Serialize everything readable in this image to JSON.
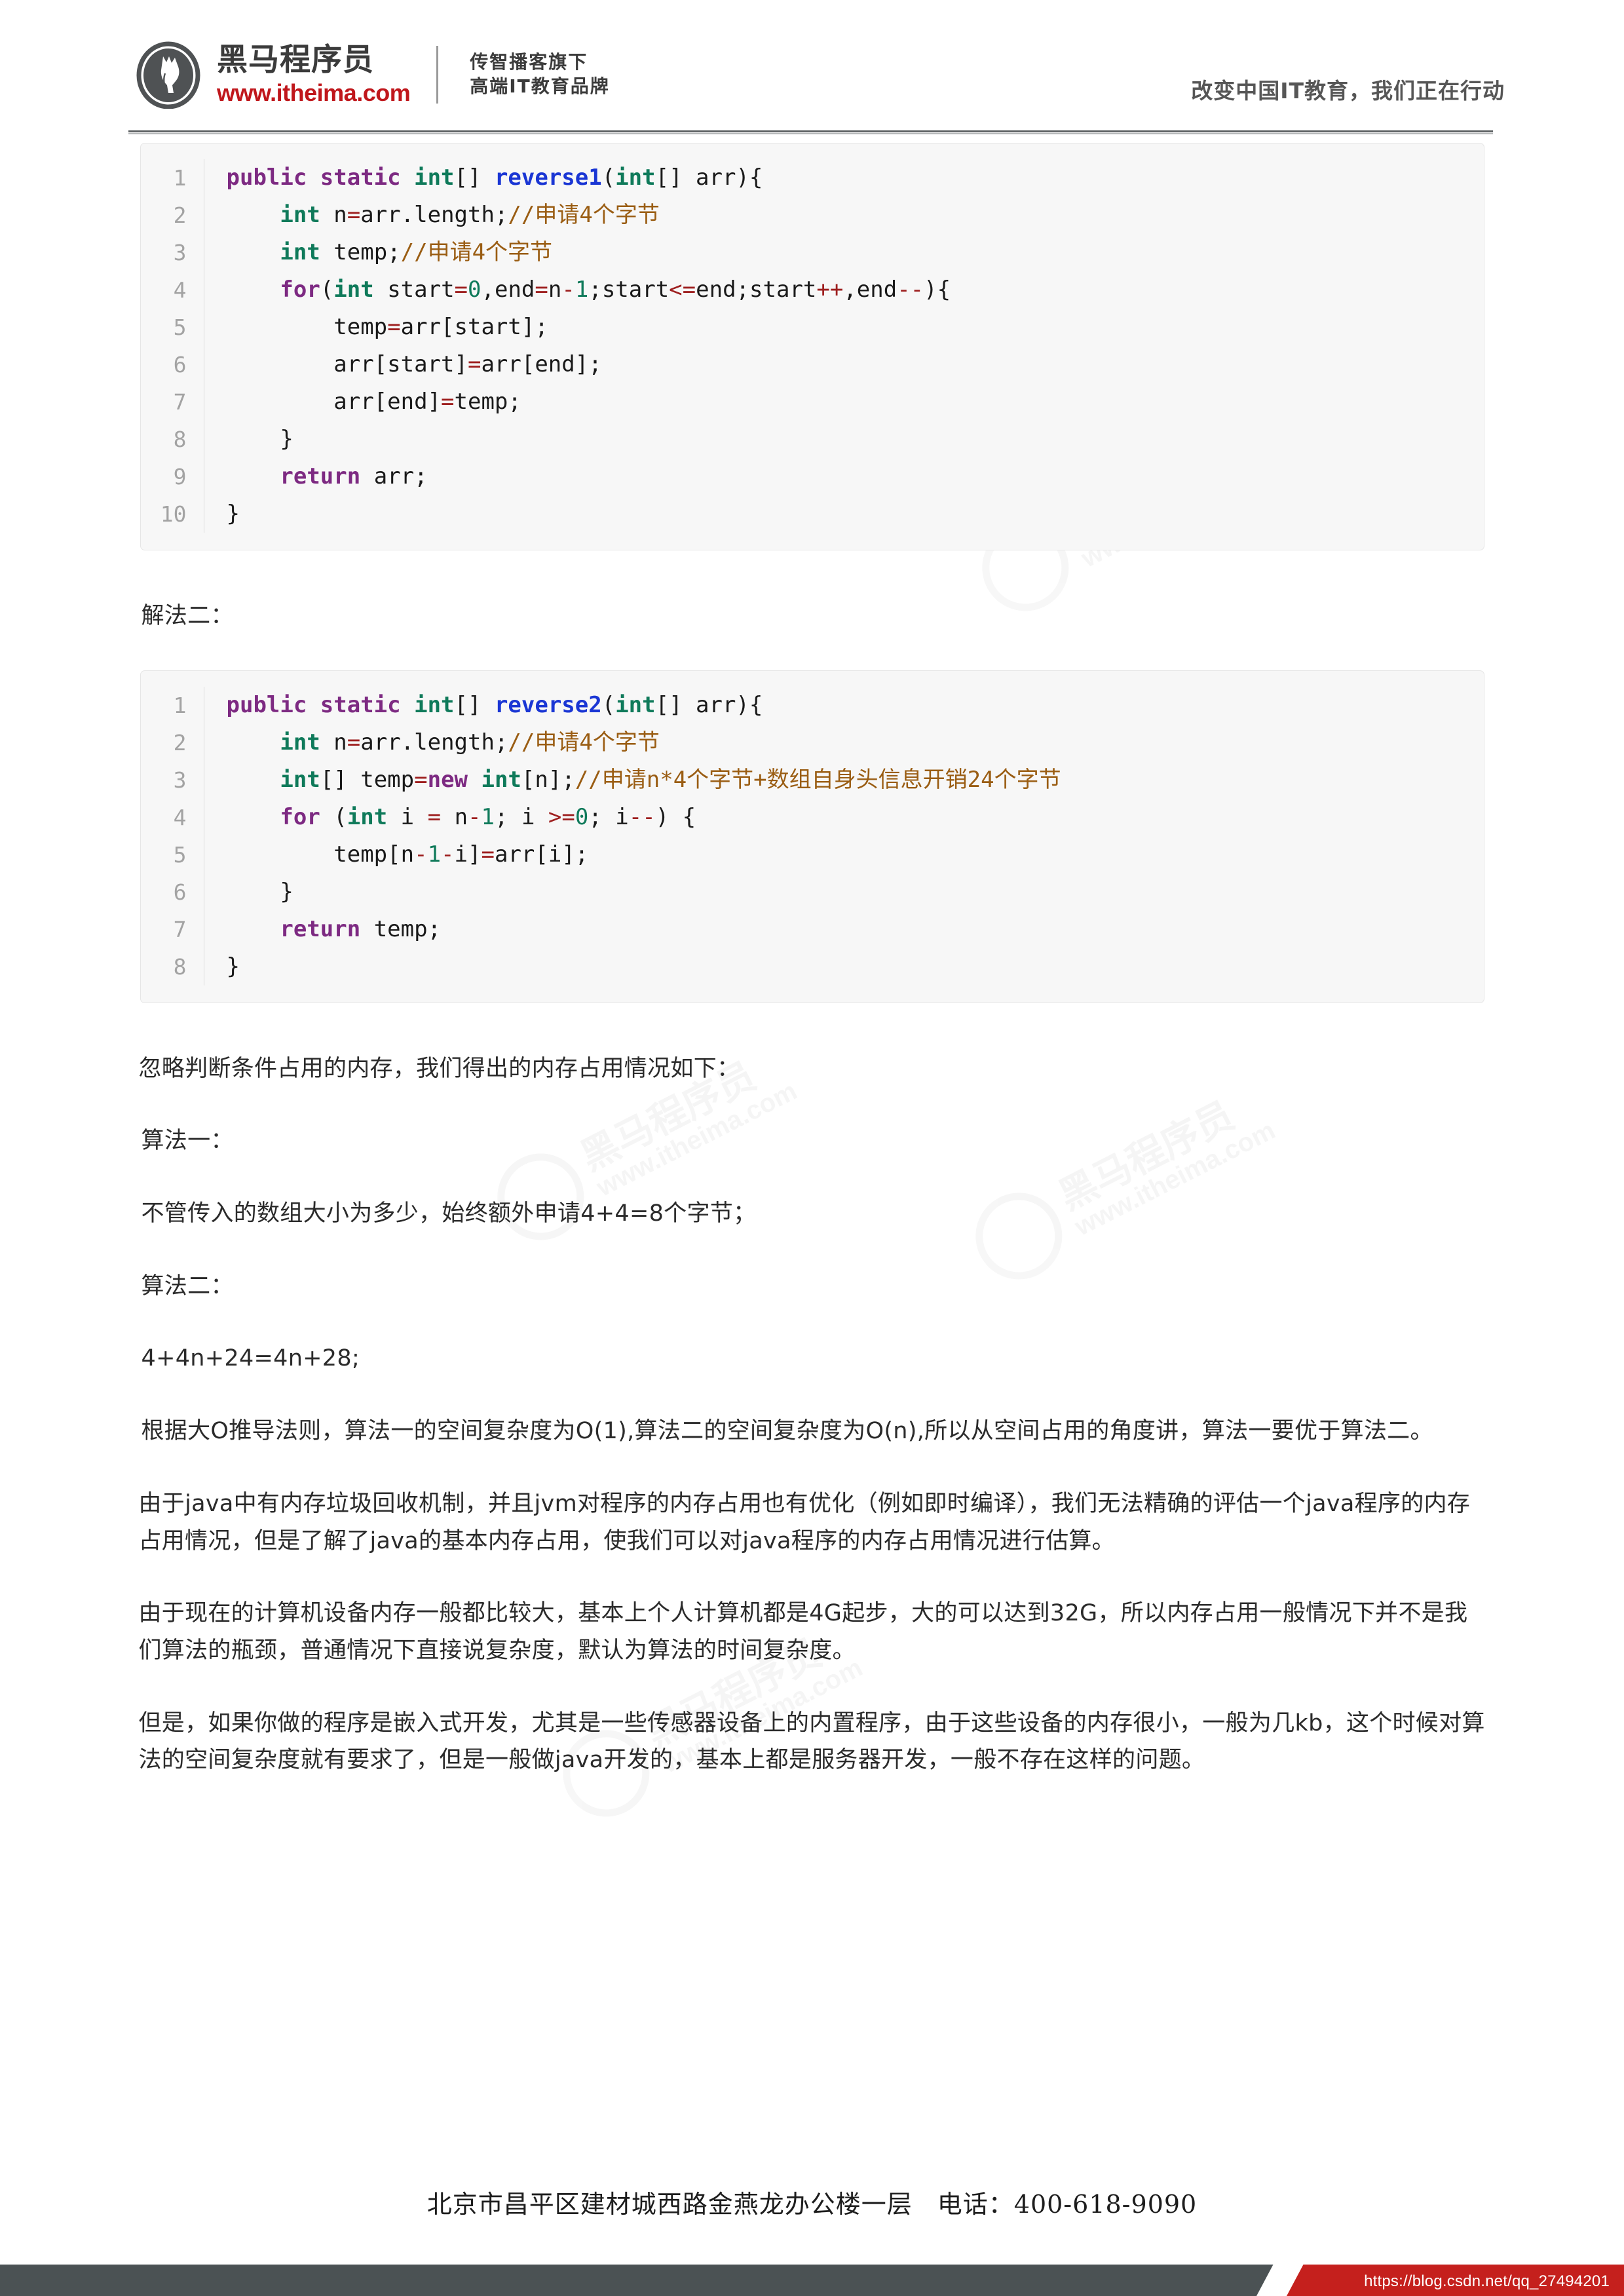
{
  "header": {
    "brand_cn": "黑马程序员",
    "brand_url": "www.itheima.com",
    "tagline_line1": "传智播客旗下",
    "tagline_line2": "高端IT教育品牌",
    "slogan": "改变中国IT教育，我们正在行动",
    "logo_icon": "horse-head-logo"
  },
  "code_block_1": {
    "name": "reverse1-code-block",
    "lines": [
      {
        "num": "1",
        "tokens": [
          {
            "t": "public ",
            "c": "kw"
          },
          {
            "t": "static ",
            "c": "kw"
          },
          {
            "t": "int",
            "c": "type"
          },
          {
            "t": "[] ",
            "c": ""
          },
          {
            "t": "reverse1",
            "c": "fn"
          },
          {
            "t": "(",
            "c": ""
          },
          {
            "t": "int",
            "c": "type"
          },
          {
            "t": "[] arr){",
            "c": ""
          }
        ]
      },
      {
        "num": "2",
        "tokens": [
          {
            "t": "    ",
            "c": ""
          },
          {
            "t": "int",
            "c": "type"
          },
          {
            "t": " n",
            "c": ""
          },
          {
            "t": "=",
            "c": "op"
          },
          {
            "t": "arr.length;",
            "c": ""
          },
          {
            "t": "//申请4个字节",
            "c": "cmt"
          }
        ]
      },
      {
        "num": "3",
        "tokens": [
          {
            "t": "    ",
            "c": ""
          },
          {
            "t": "int",
            "c": "type"
          },
          {
            "t": " temp;",
            "c": ""
          },
          {
            "t": "//申请4个字节",
            "c": "cmt"
          }
        ]
      },
      {
        "num": "4",
        "tokens": [
          {
            "t": "    ",
            "c": ""
          },
          {
            "t": "for",
            "c": "kw"
          },
          {
            "t": "(",
            "c": ""
          },
          {
            "t": "int",
            "c": "type"
          },
          {
            "t": " start",
            "c": ""
          },
          {
            "t": "=",
            "c": "op"
          },
          {
            "t": "0",
            "c": "num"
          },
          {
            "t": ",end",
            "c": ""
          },
          {
            "t": "=",
            "c": "op"
          },
          {
            "t": "n",
            "c": ""
          },
          {
            "t": "-",
            "c": "op"
          },
          {
            "t": "1",
            "c": "num"
          },
          {
            "t": ";start",
            "c": ""
          },
          {
            "t": "<=",
            "c": "op"
          },
          {
            "t": "end;start",
            "c": ""
          },
          {
            "t": "++",
            "c": "op"
          },
          {
            "t": ",end",
            "c": ""
          },
          {
            "t": "--",
            "c": "op"
          },
          {
            "t": "){",
            "c": ""
          }
        ]
      },
      {
        "num": "5",
        "tokens": [
          {
            "t": "        temp",
            "c": ""
          },
          {
            "t": "=",
            "c": "op"
          },
          {
            "t": "arr[start];",
            "c": ""
          }
        ]
      },
      {
        "num": "6",
        "tokens": [
          {
            "t": "        arr[start]",
            "c": ""
          },
          {
            "t": "=",
            "c": "op"
          },
          {
            "t": "arr[end];",
            "c": ""
          }
        ]
      },
      {
        "num": "7",
        "tokens": [
          {
            "t": "        arr[end]",
            "c": ""
          },
          {
            "t": "=",
            "c": "op"
          },
          {
            "t": "temp;",
            "c": ""
          }
        ]
      },
      {
        "num": "8",
        "tokens": [
          {
            "t": "    }",
            "c": ""
          }
        ]
      },
      {
        "num": "9",
        "tokens": [
          {
            "t": "    ",
            "c": ""
          },
          {
            "t": "return",
            "c": "kw"
          },
          {
            "t": " arr;",
            "c": ""
          }
        ]
      },
      {
        "num": "10",
        "tokens": [
          {
            "t": "}",
            "c": ""
          }
        ]
      }
    ]
  },
  "label_solution_2": "解法二：",
  "code_block_2": {
    "name": "reverse2-code-block",
    "lines": [
      {
        "num": "1",
        "tokens": [
          {
            "t": "public ",
            "c": "kw"
          },
          {
            "t": "static ",
            "c": "kw"
          },
          {
            "t": "int",
            "c": "type"
          },
          {
            "t": "[] ",
            "c": ""
          },
          {
            "t": "reverse2",
            "c": "fn"
          },
          {
            "t": "(",
            "c": ""
          },
          {
            "t": "int",
            "c": "type"
          },
          {
            "t": "[] arr){",
            "c": ""
          }
        ]
      },
      {
        "num": "2",
        "tokens": [
          {
            "t": "    ",
            "c": ""
          },
          {
            "t": "int",
            "c": "type"
          },
          {
            "t": " n",
            "c": ""
          },
          {
            "t": "=",
            "c": "op"
          },
          {
            "t": "arr.length;",
            "c": ""
          },
          {
            "t": "//申请4个字节",
            "c": "cmt"
          }
        ]
      },
      {
        "num": "3",
        "tokens": [
          {
            "t": "    ",
            "c": ""
          },
          {
            "t": "int",
            "c": "type"
          },
          {
            "t": "[] temp",
            "c": ""
          },
          {
            "t": "=",
            "c": "op"
          },
          {
            "t": "new",
            "c": "kw"
          },
          {
            "t": " ",
            "c": ""
          },
          {
            "t": "int",
            "c": "type"
          },
          {
            "t": "[n];",
            "c": ""
          },
          {
            "t": "//申请n*4个字节+数组自身头信息开销24个字节",
            "c": "cmt"
          }
        ]
      },
      {
        "num": "4",
        "tokens": [
          {
            "t": "    ",
            "c": ""
          },
          {
            "t": "for",
            "c": "kw"
          },
          {
            "t": " (",
            "c": ""
          },
          {
            "t": "int",
            "c": "type"
          },
          {
            "t": " i ",
            "c": ""
          },
          {
            "t": "=",
            "c": "op"
          },
          {
            "t": " n",
            "c": ""
          },
          {
            "t": "-",
            "c": "op"
          },
          {
            "t": "1",
            "c": "num"
          },
          {
            "t": "; i ",
            "c": ""
          },
          {
            "t": ">=",
            "c": "op"
          },
          {
            "t": "0",
            "c": "num"
          },
          {
            "t": "; i",
            "c": ""
          },
          {
            "t": "--",
            "c": "op"
          },
          {
            "t": ") {",
            "c": ""
          }
        ]
      },
      {
        "num": "5",
        "tokens": [
          {
            "t": "        temp[n",
            "c": ""
          },
          {
            "t": "-",
            "c": "op"
          },
          {
            "t": "1",
            "c": "num"
          },
          {
            "t": "-",
            "c": "op"
          },
          {
            "t": "i]",
            "c": ""
          },
          {
            "t": "=",
            "c": "op"
          },
          {
            "t": "arr[i];",
            "c": ""
          }
        ]
      },
      {
        "num": "6",
        "tokens": [
          {
            "t": "    }",
            "c": ""
          }
        ]
      },
      {
        "num": "7",
        "tokens": [
          {
            "t": "    ",
            "c": ""
          },
          {
            "t": "return",
            "c": "kw"
          },
          {
            "t": " temp;",
            "c": ""
          }
        ]
      },
      {
        "num": "8",
        "tokens": [
          {
            "t": "}",
            "c": ""
          }
        ]
      }
    ]
  },
  "body": {
    "p_intro": "忽略判断条件占用的内存，我们得出的内存占用情况如下：",
    "label_algo_1": "算法一：",
    "p_algo_1": "不管传入的数组大小为多少，始终额外申请4+4=8个字节；",
    "label_algo_2": "算法二：",
    "p_algo_2": "4+4n+24=4n+28;",
    "p_conclusion": "根据大O推导法则，算法一的空间复杂度为O(1),算法二的空间复杂度为O(n),所以从空间占用的角度讲，算法一要优于算法二。",
    "p_gc": "由于java中有内存垃圾回收机制，并且jvm对程序的内存占用也有优化（例如即时编译），我们无法精确的评估一个java程序的内存占用情况，但是了解了java的基本内存占用，使我们可以对java程序的内存占用情况进行估算。",
    "p_memory": "由于现在的计算机设备内存一般都比较大，基本上个人计算机都是4G起步，大的可以达到32G，所以内存占用一般情况下并不是我们算法的瓶颈，普通情况下直接说复杂度，默认为算法的时间复杂度。",
    "p_embedded": "但是，如果你做的程序是嵌入式开发，尤其是一些传感器设备上的内置程序，由于这些设备的内存很小，一般为几kb，这个时候对算法的空间复杂度就有要求了，但是一般做java开发的，基本上都是服务器开发，一般不存在这样的问题。"
  },
  "footer": {
    "address": "北京市昌平区建材城西路金燕龙办公楼一层",
    "phone": "电话：400-618-9090",
    "corner_url": "https://blog.csdn.net/qq_27494201"
  },
  "watermark": {
    "cn": "黑马程序员",
    "en": "www.itheima.com"
  },
  "colors": {
    "brand_red": "#c0171c",
    "corner_red": "#c5201d",
    "corner_dark": "#4b5254",
    "code_bg": "#f7f7f7",
    "keyword": "#7d2a82",
    "type": "#0f7a5a",
    "function": "#1a36d4",
    "comment": "#9a5d13",
    "operator": "#9e1f1f"
  }
}
